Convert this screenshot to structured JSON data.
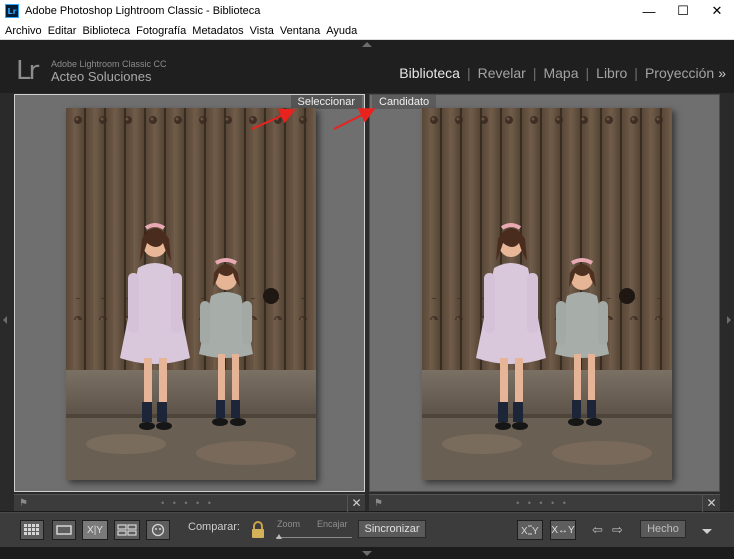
{
  "window": {
    "title": "Adobe Photoshop Lightroom Classic - Biblioteca",
    "app_badge": "Lr",
    "controls": {
      "minimize": "—",
      "maximize": "☐",
      "close": "✕"
    }
  },
  "menu": {
    "items": [
      "Archivo",
      "Editar",
      "Biblioteca",
      "Fotografía",
      "Metadatos",
      "Vista",
      "Ventana",
      "Ayuda"
    ]
  },
  "identity": {
    "logo": "Lr",
    "product": "Adobe Lightroom Classic CC",
    "owner": "Acteo Soluciones"
  },
  "modules": {
    "items": [
      "Biblioteca",
      "Revelar",
      "Mapa",
      "Libro",
      "Proyección"
    ],
    "active": "Biblioteca",
    "more": "»"
  },
  "compare": {
    "left_label": "Seleccionar",
    "right_label": "Candidato"
  },
  "footer": {
    "dots": "• • • • •",
    "close": "✕",
    "flag": "⚑"
  },
  "toolbar": {
    "compare_label": "Comparar:",
    "zoom_label": "Zoom",
    "fit_label": "Encajar",
    "sync_label": "Sincronizar",
    "done_label": "Hecho",
    "xy_label": "X|Y",
    "swap_label": "X↔Y",
    "prev": "⇦",
    "next": "⇨"
  },
  "colors": {
    "accent_red": "#e8231e",
    "active_module": "#e6e6e6",
    "inactive_module": "#a3a3a3"
  }
}
